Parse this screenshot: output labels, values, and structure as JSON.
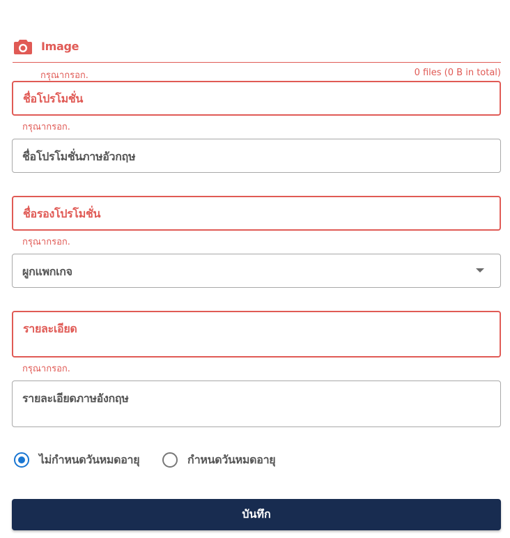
{
  "image_upload": {
    "icon": "camera-icon",
    "label": "Image",
    "helper_text": "กรุณากรอก.",
    "file_count": "0 files (0 B in total)"
  },
  "fields": {
    "promo_name": {
      "label": "ชื่อโปรโมชั่น",
      "helper_text": "กรุณากรอก."
    },
    "promo_name_en": {
      "label": "ชื่อโปรโมชั่นภาษอัวกฤษ"
    },
    "promo_subname": {
      "label": "ชื่อรองโปรโมชั่น",
      "helper_text": "กรุณากรอก."
    },
    "package_select": {
      "label": "ผูกแพกเกจ",
      "icon": "caret-down-icon"
    },
    "description": {
      "label": "รายละเอียด",
      "helper_text": "กรุณากรอก."
    },
    "description_en": {
      "label": "รายละเอียดภาษอังกฤษ"
    }
  },
  "expiry": {
    "options": [
      {
        "label": "ไม่กำหนดวันหมดอายุ",
        "selected": true
      },
      {
        "label": "กำหนดวันหมดอายุ",
        "selected": false
      }
    ]
  },
  "save_button": {
    "label": "บันทึก"
  },
  "colors": {
    "error": "#e05a55",
    "primary_button": "#182c50",
    "radio_selected": "#1976d2",
    "border_normal": "#a8a8a8"
  }
}
